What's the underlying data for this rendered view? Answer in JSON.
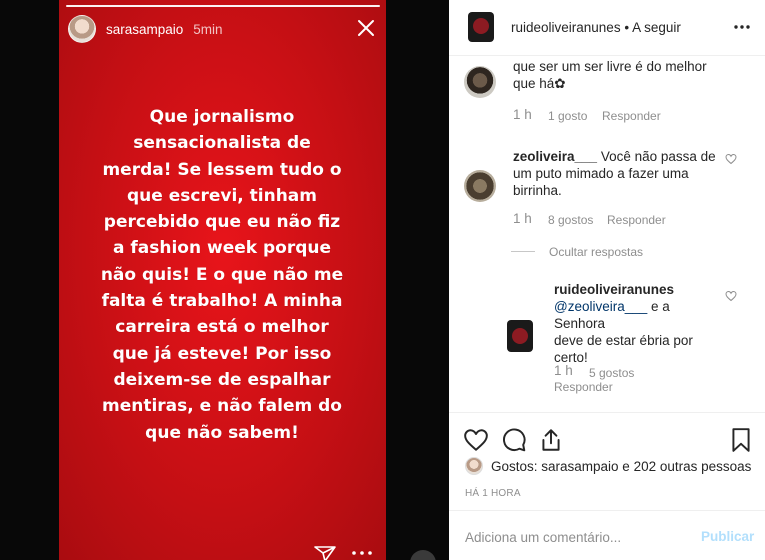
{
  "story": {
    "username": "sarasampaio",
    "time": "5min",
    "text": "Que jornalismo\nsensacionalista de\nmerda! Se lessem tudo o\nque escrevi, tinham\npercebido que eu não fiz\na fashion week porque\nnão quis! E o que não me\nfalta é trabalho! A minha\ncarreira está o melhor\nque já esteve! Por isso\ndeixem-se de espalhar\nmentiras, e não falem do\nque não sabem!",
    "background_color": "#cf1015"
  },
  "post": {
    "header": {
      "username": "ruideoliveiranunes",
      "separator": "•",
      "follow_label": "A seguir"
    },
    "comments": [
      {
        "text_partial": "que ser um ser livre é do melhor\nque há✿",
        "time": "1 h",
        "likes": "1 gosto",
        "reply": "Responder"
      },
      {
        "username": "zeoliveira___",
        "text": "Você não passa de\num puto mimado a fazer uma\nbirrinha.",
        "time": "1 h",
        "likes": "8 gostos",
        "reply": "Responder",
        "hide_replies": "Ocultar respostas"
      },
      {
        "username": "ruideoliveiranunes",
        "mention": "@zeoliveira___",
        "text": " e a Senhora\ndeve de estar ébria por\ncerto!",
        "time": "1 h",
        "likes": "5 gostos",
        "reply": "Responder"
      }
    ],
    "likes_text": "Gostos: sarasampaio e 202 outras pessoas",
    "time": "HÁ 1 HORA",
    "comment_placeholder": "Adiciona um comentário...",
    "publish_label": "Publicar",
    "link_color": "#003569",
    "publish_color": "#b2dffc"
  }
}
